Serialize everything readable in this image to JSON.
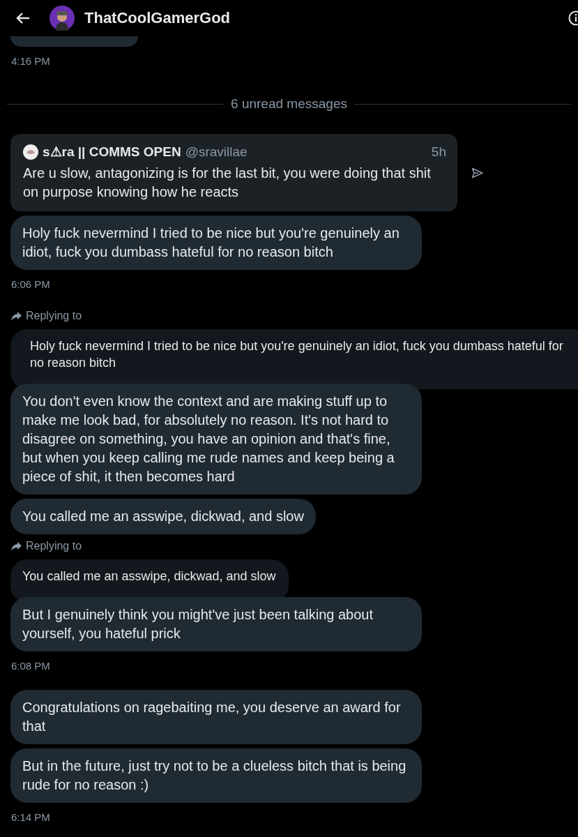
{
  "header": {
    "title": "ThatCoolGamerGod"
  },
  "divider": "6 unread messages",
  "before": [
    {
      "kind": "time",
      "text": "4:16 PM"
    }
  ],
  "items": [
    {
      "kind": "post",
      "author": "s⚠ra || COMMS OPEN",
      "handle": "@sravillae",
      "age": "5h",
      "text": "Are u slow, antagonizing is for the last bit, you were doing that shit on purpose knowing how he reacts"
    },
    {
      "kind": "bubble",
      "text": "Holy fuck nevermind I tried to be nice but you're genuinely an idiot, fuck you dumbass hateful for no reason bitch"
    },
    {
      "kind": "time",
      "text": "6:06 PM"
    },
    {
      "kind": "reply",
      "label": "Replying to",
      "text": "Holy fuck nevermind I tried to be nice but you're genuinely an idiot, fuck you dumbass hateful for no reason bitch",
      "wide": true
    },
    {
      "kind": "bubble",
      "text": "You don't even know the context and are making stuff up to make me look bad, for absolutely no reason. It's not hard to disagree on something, you have an opinion and that's fine, but when you keep calling me rude names and keep being a piece of shit, it then becomes hard"
    },
    {
      "kind": "bubble",
      "text": "You called me an asswipe, dickwad, and slow"
    },
    {
      "kind": "reply",
      "label": "Replying to",
      "text": "You called me an asswipe, dickwad, and slow",
      "wide": false
    },
    {
      "kind": "bubble",
      "text": "But I genuinely think you might've just been talking about yourself, you hateful prick"
    },
    {
      "kind": "time",
      "text": "6:08 PM"
    },
    {
      "kind": "bubble",
      "text": "Congratulations on ragebaiting me, you deserve an award for that"
    },
    {
      "kind": "bubble",
      "text": "But in the future, just try not to be a clueless bitch that is being rude for no reason :)"
    },
    {
      "kind": "time",
      "text": "6:14 PM"
    }
  ]
}
